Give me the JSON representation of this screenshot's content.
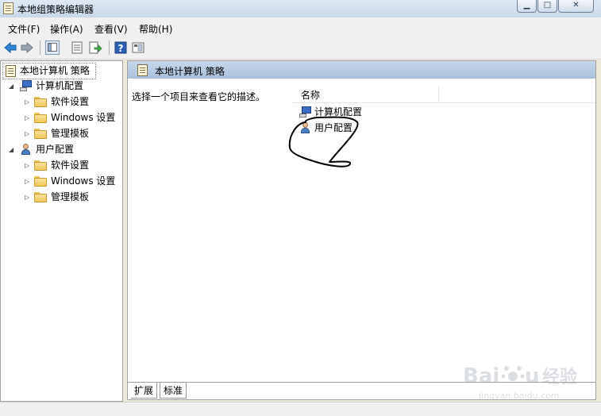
{
  "window": {
    "title": "本地组策略编辑器"
  },
  "menu": [
    "文件(F)",
    "操作(A)",
    "查看(V)",
    "帮助(H)"
  ],
  "toolbar": {
    "icons": [
      "back-icon",
      "forward-icon",
      "up-icon",
      "show-hide-tree-icon",
      "properties-icon",
      "export-icon",
      "help-icon",
      "view-icon"
    ]
  },
  "tree": {
    "root": "本地计算机 策略",
    "computer": {
      "label": "计算机配置",
      "children": [
        "软件设置",
        "Windows 设置",
        "管理模板"
      ]
    },
    "user": {
      "label": "用户配置",
      "children": [
        "软件设置",
        "Windows 设置",
        "管理模板"
      ]
    }
  },
  "right": {
    "header": "本地计算机 策略",
    "description": "选择一个项目来查看它的描述。",
    "column": "名称",
    "items": [
      "计算机配置",
      "用户配置"
    ]
  },
  "tabs": [
    "扩展",
    "标准"
  ],
  "watermark": {
    "brand": "Baidu",
    "suffix": "经验",
    "url": "jingyan.baidu.com"
  }
}
